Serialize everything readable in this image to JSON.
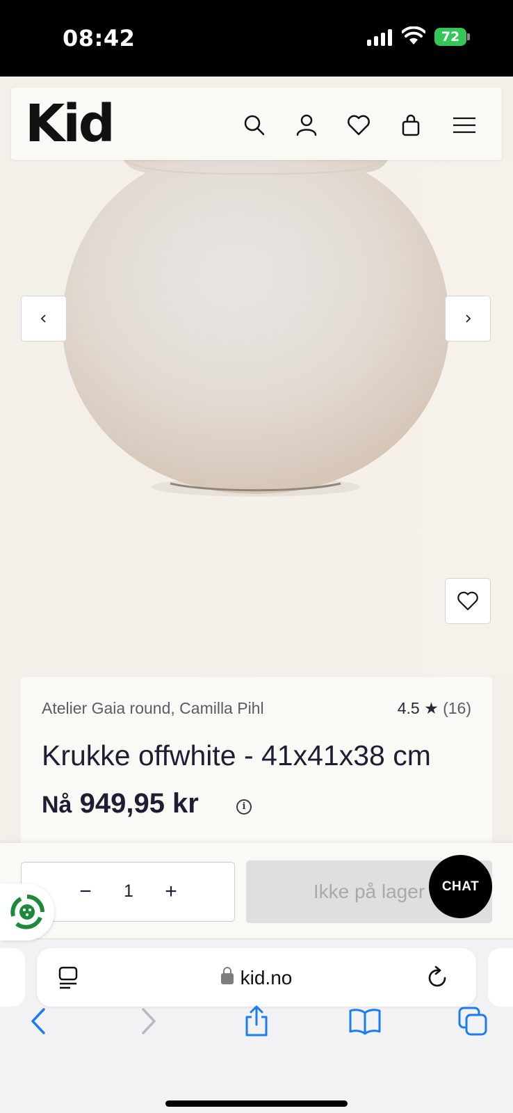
{
  "status_bar": {
    "time": "08:42",
    "battery": "72"
  },
  "header": {
    "logo": "Kid"
  },
  "product": {
    "brand": "Atelier Gaia round, Camilla Pihl",
    "rating": "4.5 ★",
    "review_count": "(16)",
    "title": "Krukke offwhite - 41x41x38 cm",
    "price_prefix": "Nå",
    "price": "949,95 kr"
  },
  "buy": {
    "quantity": "1",
    "minus": "−",
    "plus": "+",
    "stock_button": "Ikke på lager"
  },
  "chat": {
    "label": "CHAT"
  },
  "browser": {
    "url": "kid.no"
  },
  "colors": {
    "background": "#f4efe8",
    "card": "#fbf9f5",
    "text": "#1f1d33",
    "battery": "#33c759",
    "safari_blue": "#1a7cf5"
  }
}
